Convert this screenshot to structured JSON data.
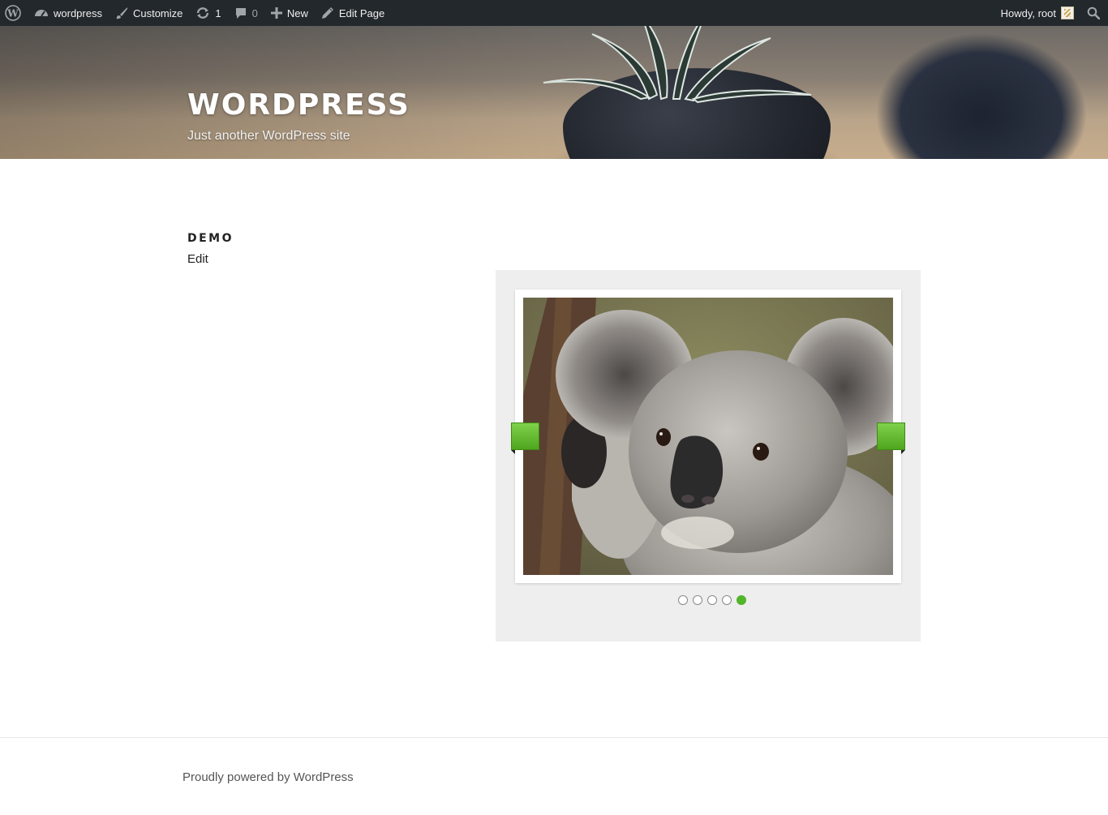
{
  "adminbar": {
    "site_name": "wordpress",
    "customize": "Customize",
    "updates_count": "1",
    "comments_count": "0",
    "new_label": "New",
    "edit_page": "Edit Page",
    "greeting": "Howdy, root"
  },
  "header": {
    "site_title": "WORDPRESS",
    "tagline": "Just another WordPress site"
  },
  "entry": {
    "title": "DEMO",
    "edit_link": "Edit"
  },
  "slider": {
    "slide_count": 5,
    "active_slide": 5,
    "accent_color": "#52b52a"
  },
  "footer": {
    "credit": "Proudly powered by WordPress"
  }
}
